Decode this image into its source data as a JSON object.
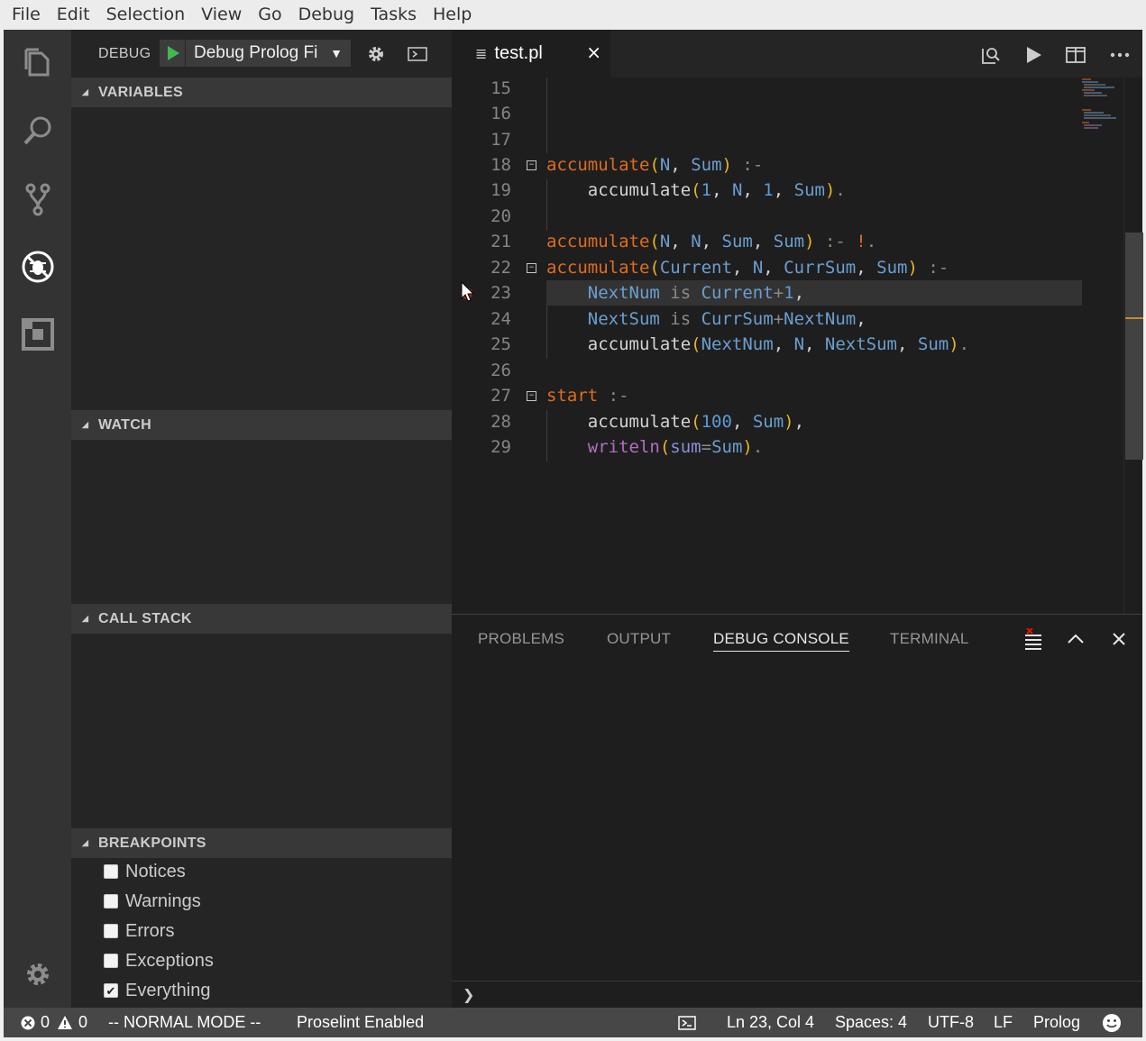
{
  "menu": [
    "File",
    "Edit",
    "Selection",
    "View",
    "Go",
    "Debug",
    "Tasks",
    "Help"
  ],
  "activity": {
    "items": [
      "files-icon",
      "search-icon",
      "source-control-icon",
      "debug-icon",
      "extensions-icon"
    ],
    "manage": "gear-icon"
  },
  "sidebar": {
    "debug_label": "DEBUG",
    "config": "Debug Prolog Fi",
    "sections": {
      "variables": "VARIABLES",
      "watch": "WATCH",
      "call_stack": "CALL STACK",
      "breakpoints": "BREAKPOINTS"
    },
    "breakpoints": [
      {
        "label": "Notices",
        "checked": false
      },
      {
        "label": "Warnings",
        "checked": false
      },
      {
        "label": "Errors",
        "checked": false
      },
      {
        "label": "Exceptions",
        "checked": false
      },
      {
        "label": "Everything",
        "checked": true
      }
    ]
  },
  "editor": {
    "tab": {
      "label": "test.pl",
      "close": "×"
    },
    "line_numbers": [
      "15",
      "16",
      "17",
      "18",
      "19",
      "20",
      "21",
      "22",
      "23",
      "24",
      "25",
      "26",
      "27",
      "28",
      "29"
    ],
    "current_line": "23"
  },
  "panel": {
    "tabs": [
      "PROBLEMS",
      "OUTPUT",
      "DEBUG CONSOLE",
      "TERMINAL"
    ],
    "active_tab": "DEBUG CONSOLE",
    "prompt": "❯"
  },
  "status": {
    "errors": "0",
    "warnings": "0",
    "mode": "-- NORMAL MODE --",
    "proselint": "Proselint Enabled",
    "position": "Ln 23, Col 4",
    "spaces": "Spaces: 4",
    "encoding": "UTF-8",
    "eol": "LF",
    "language": "Prolog"
  }
}
